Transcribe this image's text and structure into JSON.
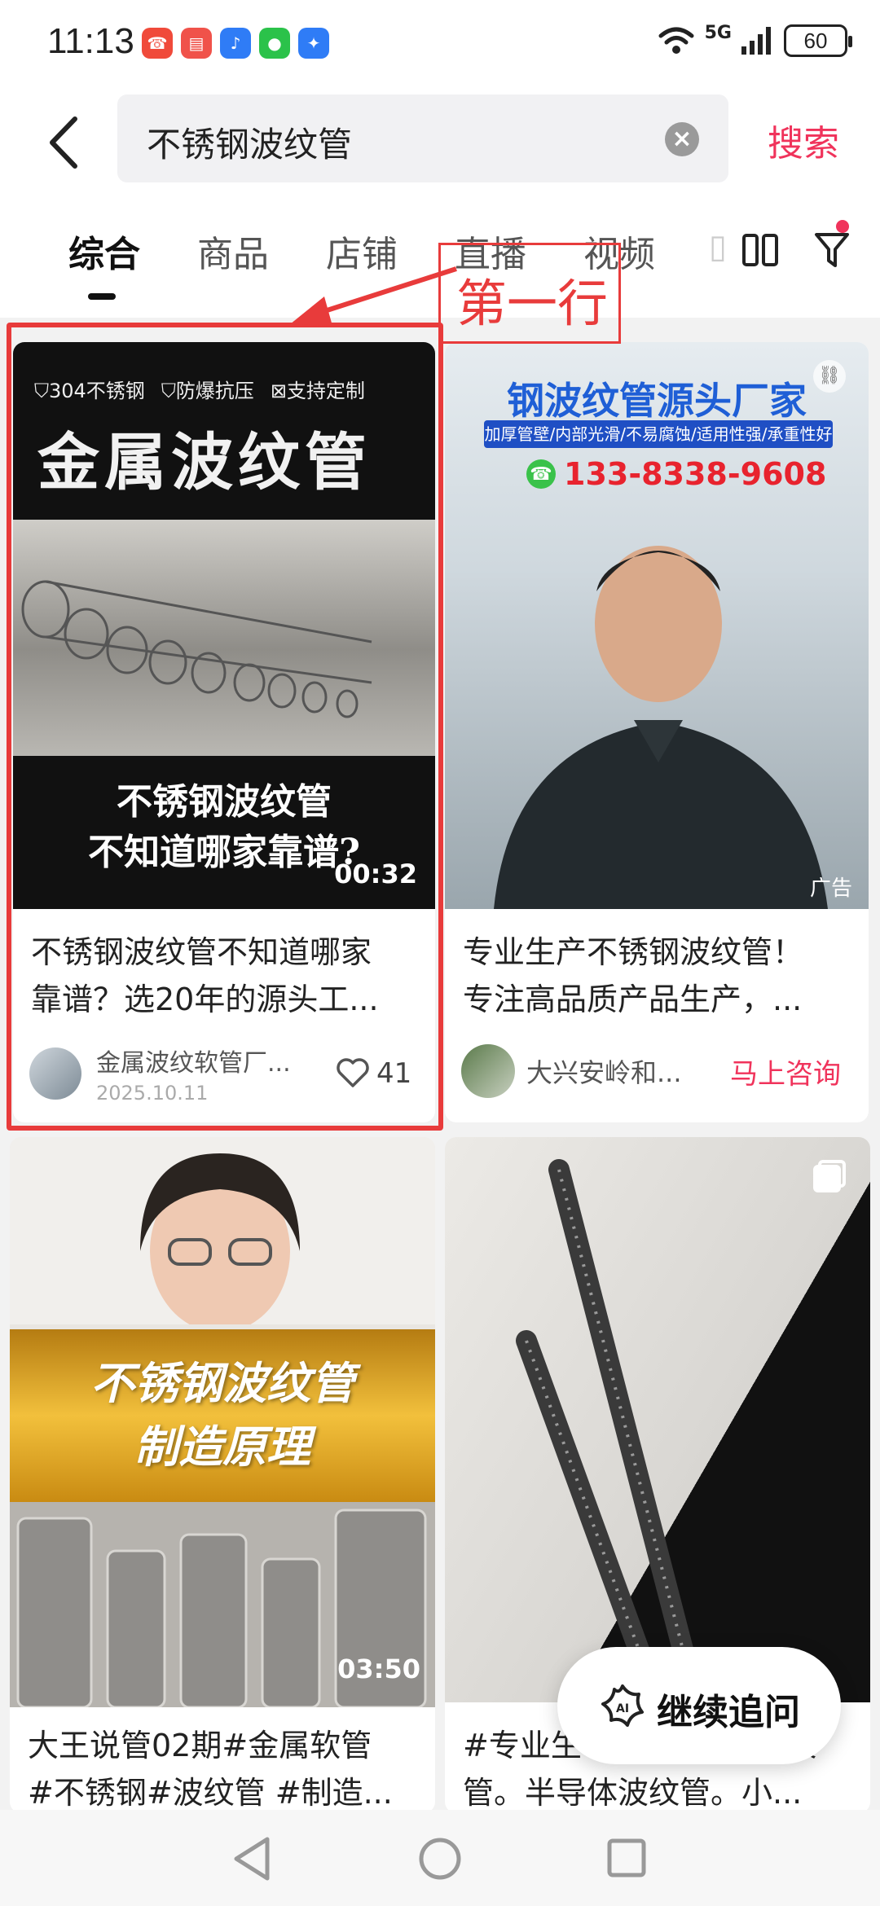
{
  "status": {
    "time": "11:13",
    "network": "5G",
    "battery": "60"
  },
  "search": {
    "query": "不锈钢波纹管",
    "action_label": "搜索"
  },
  "tabs": [
    {
      "label": "综合",
      "active": true
    },
    {
      "label": "商品",
      "active": false
    },
    {
      "label": "店铺",
      "active": false
    },
    {
      "label": "直播",
      "active": false
    },
    {
      "label": "视频",
      "active": false
    }
  ],
  "annotation": {
    "label": "第一行"
  },
  "cards": [
    {
      "badges": [
        "304不锈钢",
        "防爆抗压",
        "支持定制"
      ],
      "banner": "金属波纹管",
      "caption_line1": "不锈钢波纹管",
      "caption_line2": "不知道哪家靠谱?",
      "duration": "00:32",
      "title_line1": "不锈钢波纹管不知道哪家",
      "title_line2": "靠谱？选20年的源头工...",
      "author": "金属波纹软管厂...",
      "date": "2025.10.11",
      "likes": "41"
    },
    {
      "headline": "钢波纹管源头厂家",
      "subhead": "加厚管壁/内部光滑/不易腐蚀/适用性强/承重性好",
      "phone": "133-8338-9608",
      "ad_label": "广告",
      "title_line1": "专业生产不锈钢波纹管！",
      "title_line2": "专注高品质产品生产，...",
      "author": "大兴安岭和...",
      "cta": "马上咨询"
    },
    {
      "banner_line1": "不锈钢波纹管",
      "banner_line2": "制造原理",
      "duration": "03:50",
      "title_line1": "大王说管02期#金属软管",
      "title_line2": "#不锈钢#波纹管 #制造..."
    },
    {
      "title_line1": "#专业生",
      "title_line1_tail": "纹",
      "title_line2": "管。半导体波纹管。小..."
    }
  ],
  "float_button": {
    "label": "继续追问",
    "icon": "ai-icon"
  },
  "colors": {
    "accent": "#f0335b",
    "annotation": "#e83b3b"
  }
}
